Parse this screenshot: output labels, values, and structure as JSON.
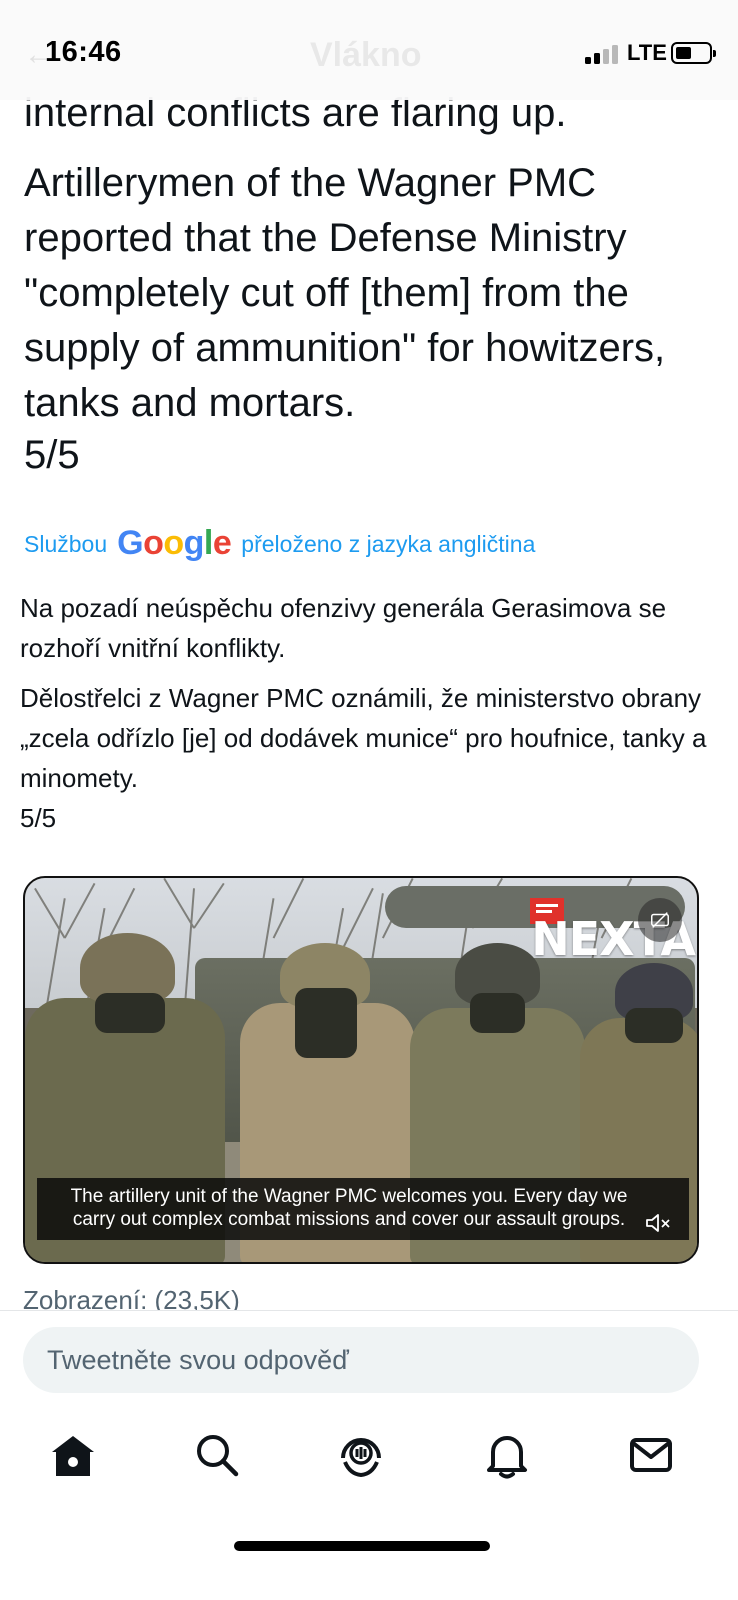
{
  "status_bar": {
    "time": "16:46",
    "network": "LTE",
    "nav_title_ghost": "Vlákno"
  },
  "tweet": {
    "original_paragraph_1": "internal conflicts are flaring up.",
    "original_paragraph_2": "Artillerymen of the Wagner PMC reported that the Defense Ministry \"completely cut off [them] from the supply of ammunition\" for howitzers, tanks and mortars.",
    "original_counter": "5/5",
    "translation_prefix": "Službou",
    "translation_brand": "Google",
    "translation_suffix": "přeloženo z jazyka angličtina",
    "translated_paragraph_1": "Na pozadí neúspěchu ofenzivy generála Gerasimova se rozhoří vnitřní konflikty.",
    "translated_paragraph_2": "Dělostřelci z Wagner PMC oznámili, že ministerstvo obrany „zcela odřízlo [je] od dodávek munice“ pro houfnice, tanky a minomety.",
    "translated_counter": "5/5"
  },
  "video": {
    "watermark": "NEXTA",
    "subtitle": "The artillery unit of the Wagner PMC welcomes you. Every day we carry out complex combat missions and cover our assault groups.",
    "cc_icon": "closed-captions-icon",
    "mute_icon": "speaker-muted-icon"
  },
  "views": {
    "text": "Zobrazení: (23,5K)"
  },
  "reply": {
    "placeholder": "Tweetněte svou odpověď"
  },
  "tabbar": {
    "items": [
      {
        "icon": "home-icon"
      },
      {
        "icon": "search-icon"
      },
      {
        "icon": "spaces-icon"
      },
      {
        "icon": "notifications-icon"
      },
      {
        "icon": "messages-icon"
      }
    ]
  },
  "colors": {
    "accent": "#1d9bf0",
    "text": "#0f1419",
    "secondary_text": "#536471",
    "input_bg": "#eff3f4"
  }
}
